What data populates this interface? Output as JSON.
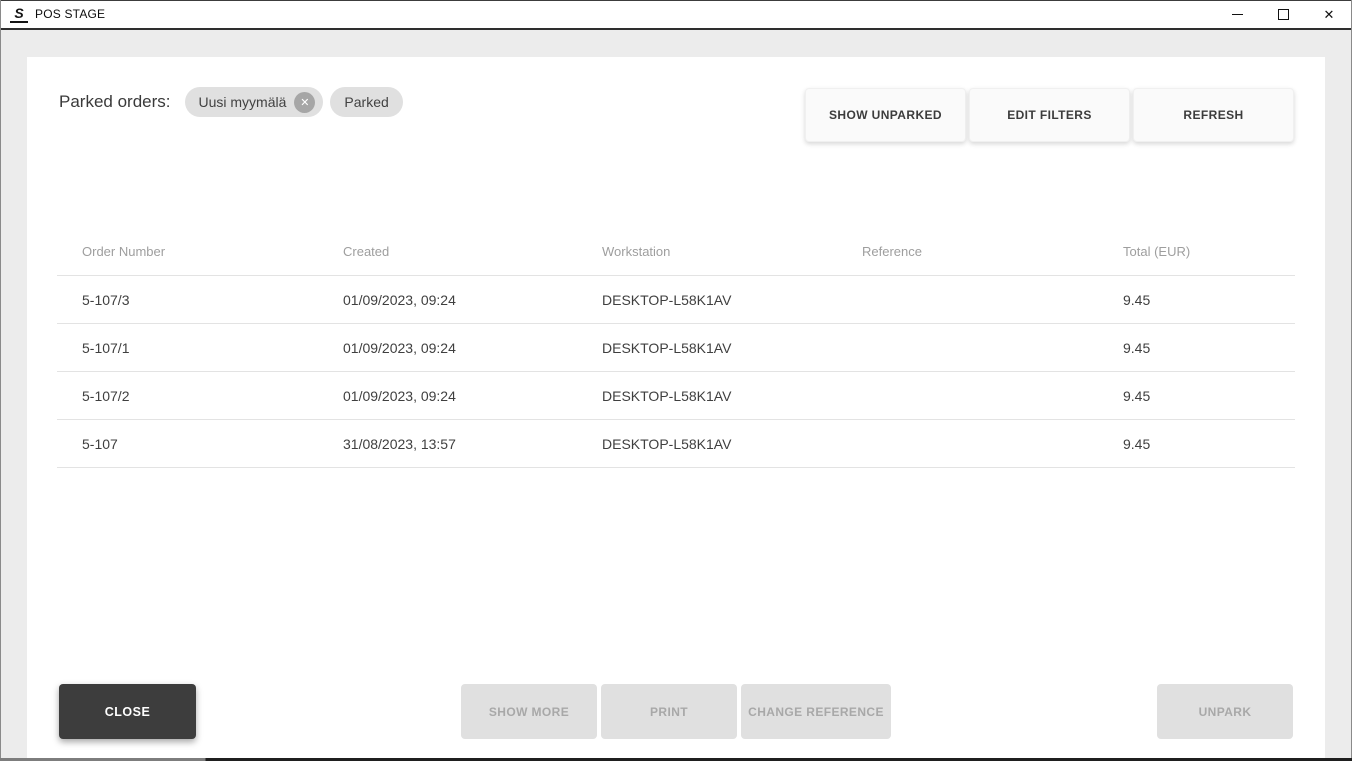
{
  "window": {
    "title": "POS STAGE"
  },
  "icons": {
    "app_logo": "S",
    "close": "✕",
    "chip_remove": "✕"
  },
  "header": {
    "label": "Parked orders:",
    "chips": [
      {
        "label": "Uusi myymälä",
        "removable": true
      },
      {
        "label": "Parked",
        "removable": false
      }
    ],
    "buttons": [
      {
        "label": "SHOW UNPARKED"
      },
      {
        "label": "EDIT FILTERS"
      },
      {
        "label": "REFRESH"
      }
    ]
  },
  "table": {
    "columns": [
      "Order Number",
      "Created",
      "Workstation",
      "Reference",
      "Total (EUR)"
    ],
    "rows": [
      {
        "order_number": "5-107/3",
        "created": "01/09/2023, 09:24",
        "workstation": "DESKTOP-L58K1AV",
        "reference": "",
        "total": "9.45"
      },
      {
        "order_number": "5-107/1",
        "created": "01/09/2023, 09:24",
        "workstation": "DESKTOP-L58K1AV",
        "reference": "",
        "total": "9.45"
      },
      {
        "order_number": "5-107/2",
        "created": "01/09/2023, 09:24",
        "workstation": "DESKTOP-L58K1AV",
        "reference": "",
        "total": "9.45"
      },
      {
        "order_number": "5-107",
        "created": "31/08/2023, 13:57",
        "workstation": "DESKTOP-L58K1AV",
        "reference": "",
        "total": "9.45"
      }
    ]
  },
  "footer": {
    "close_label": "CLOSE",
    "show_more_label": "SHOW MORE",
    "print_label": "PRINT",
    "change_reference_label": "CHANGE REFERENCE",
    "unpark_label": "UNPARK",
    "disabled_buttons": [
      "SHOW MORE",
      "PRINT",
      "CHANGE REFERENCE",
      "UNPARK"
    ]
  },
  "colors": {
    "background": "#ececec",
    "panel": "#ffffff",
    "chip_bg": "#e0e0e0",
    "chip_remove_bg": "#a6a6a6",
    "close_button_bg": "#3d3d3d",
    "disabled_button_bg": "#e0e0e0",
    "disabled_button_text": "#a8a8a8",
    "table_border": "#e3e3e3",
    "header_text": "#9e9e9e"
  }
}
